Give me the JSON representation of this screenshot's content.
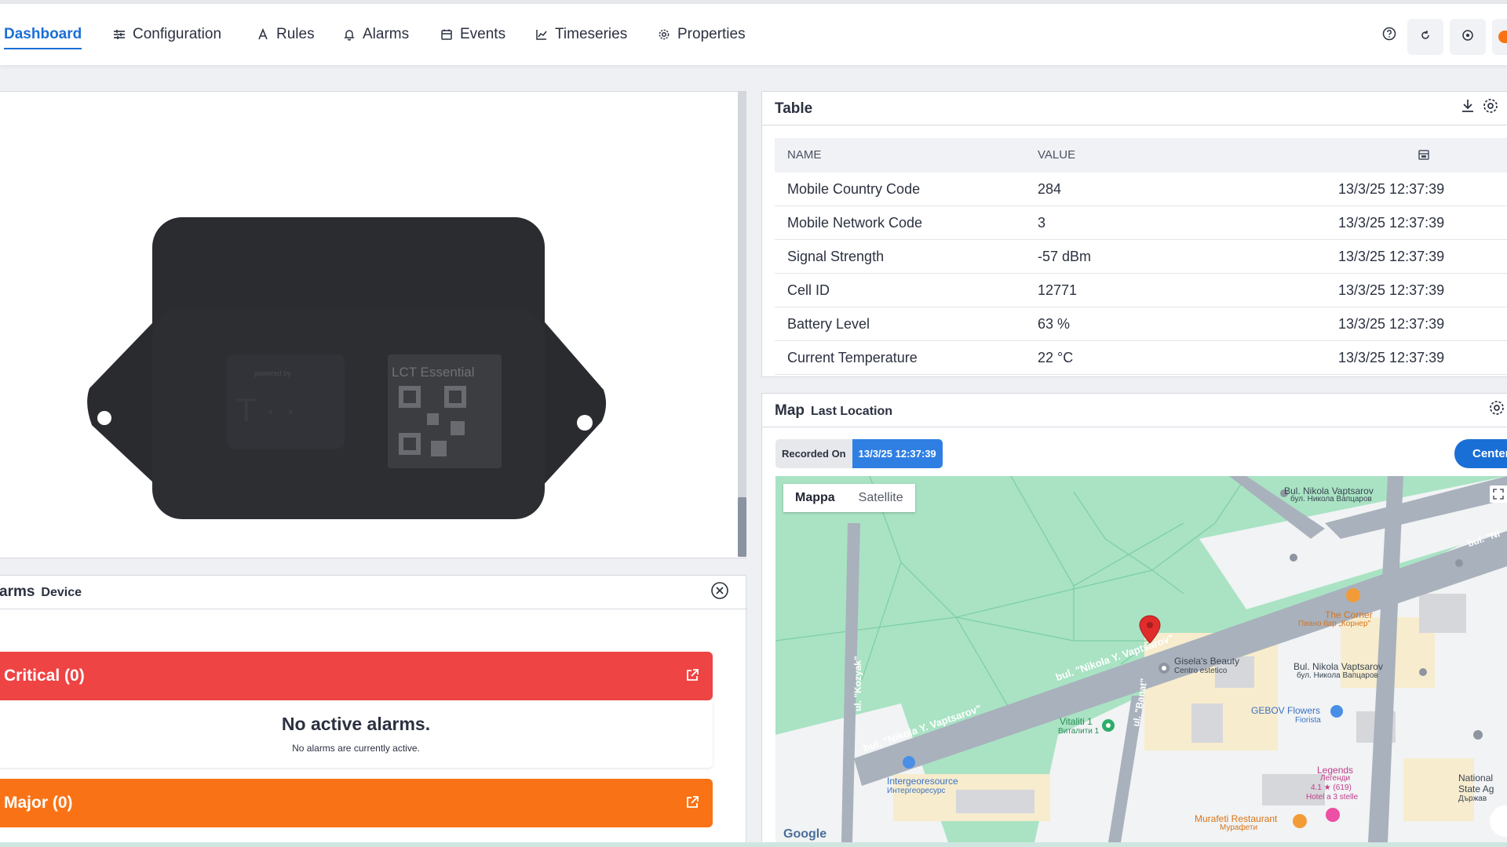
{
  "nav": {
    "tabs": [
      {
        "label": "Dashboard",
        "icon": "dashboard-icon"
      },
      {
        "label": "Configuration",
        "icon": "sliders-icon"
      },
      {
        "label": "Rules",
        "icon": "rules-icon"
      },
      {
        "label": "Alarms",
        "icon": "bell-icon"
      },
      {
        "label": "Events",
        "icon": "calendar-icon"
      },
      {
        "label": "Timeseries",
        "icon": "chart-line-icon"
      },
      {
        "label": "Properties",
        "icon": "gear-icon"
      }
    ],
    "active_tab": "Dashboard",
    "right_icons": [
      "help-icon",
      "refresh-icon",
      "settings-circle-icon"
    ]
  },
  "device_panel": {
    "image_alt": "device-image",
    "device_text": {
      "powered_by": "powered by",
      "product": "LCT Essential"
    }
  },
  "alarms_panel": {
    "title": "arms",
    "subtitle": "Device",
    "critical": {
      "label": "Critical (0)",
      "color": "#ef4444"
    },
    "empty_title": "No active alarms.",
    "empty_sub": "No alarms are currently active.",
    "major": {
      "label": "Major (0)",
      "color": "#f97316"
    }
  },
  "table_panel": {
    "title": "Table",
    "columns": [
      "NAME",
      "VALUE"
    ],
    "rows": [
      {
        "name": "Mobile Country Code",
        "value": "284",
        "time": "13/3/25 12:37:39"
      },
      {
        "name": "Mobile Network Code",
        "value": "3",
        "time": "13/3/25 12:37:39"
      },
      {
        "name": "Signal Strength",
        "value": "-57 dBm",
        "time": "13/3/25 12:37:39"
      },
      {
        "name": "Cell ID",
        "value": "12771",
        "time": "13/3/25 12:37:39"
      },
      {
        "name": "Battery Level",
        "value": "63 %",
        "time": "13/3/25 12:37:39"
      },
      {
        "name": "Current Temperature",
        "value": "22 °C",
        "time": "13/3/25 12:37:39"
      }
    ]
  },
  "map_panel": {
    "title": "Map",
    "subtitle": "Last Location",
    "recorded_label": "Recorded On",
    "recorded_value": "13/3/25 12:37:39",
    "center_button": "Center",
    "map_type_tabs": [
      "Mappa",
      "Satellite"
    ],
    "places": [
      {
        "label": "Bul. Nikola Vaptsarov"
      },
      {
        "label": "бул. Никола Вапцаров"
      },
      {
        "label": "The Corner"
      },
      {
        "label": "Пиано бар „Корнер\""
      },
      {
        "label": "Gisela's Beauty"
      },
      {
        "label": "Centro estetico"
      },
      {
        "label": "Bul. Nikola Vaptsarov"
      },
      {
        "label": "бул. Никола Вапцаров"
      },
      {
        "label": "GEBOV Flowers"
      },
      {
        "label": "Fiorista"
      },
      {
        "label": "Vitaliti 1"
      },
      {
        "label": "Виталити 1"
      },
      {
        "label": "Intergeoresource"
      },
      {
        "label": "Интергеоресурс"
      },
      {
        "label": "Legends"
      },
      {
        "label": "Легенди"
      },
      {
        "label": "4.1 ★ (619)"
      },
      {
        "label": "Hotel a 3 stelle"
      },
      {
        "label": "Murafeti Restaurant"
      },
      {
        "label": "Мурафети"
      },
      {
        "label": "National"
      },
      {
        "label": "State Ag"
      },
      {
        "label": "Държав"
      }
    ],
    "streets": [
      "bul. \"Nikola Y. Vaptsarov\"",
      "bul. \"Nikola Y. Vaptsarov\"",
      "ul. \"Kozyak\"",
      "ul. \"Banat\"",
      "bul. \"Ni"
    ],
    "google_label": "Google"
  }
}
